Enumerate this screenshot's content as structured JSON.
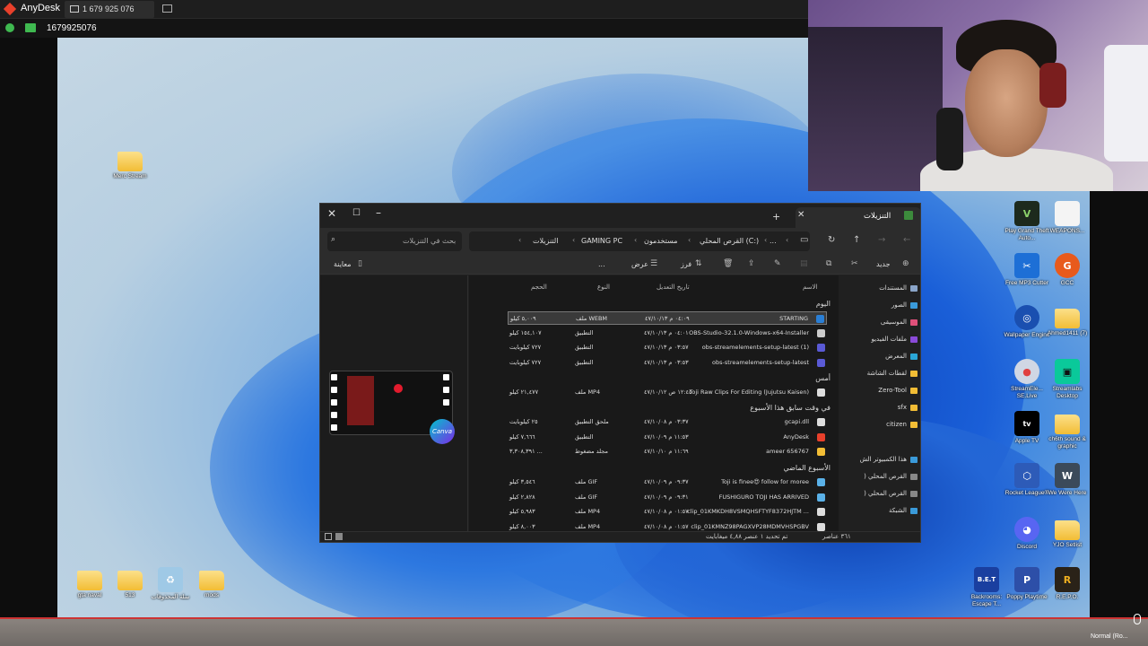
{
  "anydesk": {
    "app_name": "AnyDesk",
    "tab_address": "1 679 925 076",
    "session_id": "1679925076",
    "status_text": "Normal (Ro..."
  },
  "desktop_icons": [
    {
      "label": "Merc Stream",
      "icon": "folder-icon"
    },
    {
      "label": "gta naval",
      "icon": "folder-icon"
    },
    {
      "label": "513",
      "icon": "folder-icon"
    },
    {
      "label": "سلة المحذوفات",
      "icon": "recycle-bin-icon"
    },
    {
      "label": "mods",
      "icon": "folder-icon"
    },
    {
      "label": "Play Grand Theft Auto...",
      "icon": "gta-v-icon"
    },
    {
      "label": "WEAPONS...",
      "icon": "file-icon"
    },
    {
      "label": "Free MP3 Cutter",
      "icon": "mp3-cutter-icon"
    },
    {
      "label": "GCC",
      "icon": "gcc-icon"
    },
    {
      "label": "Wallpaper Engine",
      "icon": "wallpaper-engine-icon"
    },
    {
      "label": "Ahmed1411 (7)",
      "icon": "folder-icon"
    },
    {
      "label": "StreamEle... SE.Live",
      "icon": "streamelements-icon"
    },
    {
      "label": "Streamlabs Desktop",
      "icon": "streamlabs-icon"
    },
    {
      "label": "Apple TV",
      "icon": "apple-tv-icon"
    },
    {
      "label": "ch6th sound & graphic",
      "icon": "folder-icon"
    },
    {
      "label": "Rocket League®",
      "icon": "rocket-league-icon"
    },
    {
      "label": "We Were Here",
      "icon": "we-were-here-icon"
    },
    {
      "label": "Discord",
      "icon": "discord-icon"
    },
    {
      "label": "YJO Setlist",
      "icon": "folder-icon"
    },
    {
      "label": "Backrooms: Escape T...",
      "icon": "bet-game-icon"
    },
    {
      "label": "Poppy Playtime",
      "icon": "poppy-playtime-icon"
    },
    {
      "label": "R.E.P.O.",
      "icon": "repo-game-icon"
    }
  ],
  "explorer": {
    "tab_title": "التنزيلات",
    "search_placeholder": "بحث في التنزيلات",
    "breadcrumbs": [
      "التنزيلات",
      "GAMING PC",
      "مستخدمون",
      "القرص المحلي (C:)"
    ],
    "more_crumbs": "...",
    "toolbar": {
      "new": "جديد",
      "sort": "فرز",
      "view": "عرض",
      "more": "...",
      "preview": "معاينة"
    },
    "columns": {
      "name": "الاسم",
      "date": "تاريخ التعديل",
      "type": "النوع",
      "size": "الحجم"
    },
    "groups": [
      {
        "title": "اليوم",
        "rows": [
          {
            "name": "STARTING",
            "date": "٠٤:٠٩ م ٤٧/١٠/١٣",
            "type": "ملف WEBM",
            "size": "٥,٠٠٩ كيلو",
            "selected": true,
            "icon_color": "#2a7fd6"
          },
          {
            "name": "OBS-Studio-32.1.0-Windows-x64-Installer",
            "date": "٠٤:٠١ م ٤٧/١٠/١٣",
            "type": "التطبيق",
            "size": "١٥٤,١٠٧ كيلو",
            "icon_color": "#cccccc"
          },
          {
            "name": "obs-streamelements-setup-latest (1)",
            "date": "٠٣:٥٧ م ٤٧/١٠/١٣",
            "type": "التطبيق",
            "size": "٧٢٧ كيلوبايت",
            "icon_color": "#5a5ad6"
          },
          {
            "name": "obs-streamelements-setup-latest",
            "date": "٠٣:٥٣ م ٤٧/١٠/١٣",
            "type": "التطبيق",
            "size": "٧٢٧ كيلوبايت",
            "icon_color": "#5a5ad6"
          }
        ]
      },
      {
        "title": "أمس",
        "rows": [
          {
            "name": "Toji Raw Clips For Editing (Jujutsu Kaisen)",
            "date": "١٢:٤٥ ص ٤٧/١٠/١٢",
            "type": "ملف MP4",
            "size": "٢١,٤٧٧ كيلو",
            "icon_color": "#dddddd"
          }
        ]
      },
      {
        "title": "في وقت سابق هذا الأسبوع",
        "rows": [
          {
            "name": "gcapi.dll",
            "date": "٠٣:٣٧ م ٤٧/١٠/٠٨",
            "type": "ملحق التطبيق",
            "size": "٢٥ كيلوبايت",
            "icon_color": "#dddddd"
          },
          {
            "name": "AnyDesk",
            "date": "١١:٥٣ م ٤٧/١٠/٠٩",
            "type": "التطبيق",
            "size": "٧,٦٦٦ كيلو",
            "icon_color": "#e8402b"
          },
          {
            "name": "ameer 656767",
            "date": "١١:٦٩ م ٤٧/١٠/١٠",
            "type": "مجلد مضغوط",
            "size": "٣,٣٠٨,٣٩١ ...",
            "icon_color": "#f2bd35"
          }
        ]
      },
      {
        "title": "الأسبوع الماضي",
        "rows": [
          {
            "name": "Toji is finee😍 follow for moree",
            "date": "٠٩:٣٧ م ٤٧/١٠/٠٩",
            "type": "ملف GIF",
            "size": "٣,٥٤٦ كيلو",
            "icon_color": "#5ab1e8"
          },
          {
            "name": "FUSHIGURO TOJI HAS ARRIVED",
            "date": "٠٩:٣١ م ٤٧/١٠/٠٩",
            "type": "ملف GIF",
            "size": "٢,٨٢٨ كيلو",
            "icon_color": "#5ab1e8"
          },
          {
            "name": "clip_01KMKDH8VSMQHSFTYF8372HJTM ...",
            "date": "٠١:٥٧ م ٤٧/١٠/٠٨",
            "type": "ملف MP4",
            "size": "٥,٩٨٣ كيلو",
            "icon_color": "#dddddd"
          },
          {
            "name": "clip_01KMNZ98PAGXVP28MDMVHSPGBV",
            "date": "٠١:٥٧ م ٤٧/١٠/٠٨",
            "type": "ملف MP4",
            "size": "٨,٠٠٣ كيلو",
            "icon_color": "#dddddd"
          }
        ]
      }
    ],
    "nav": [
      {
        "label": "المستندات",
        "color": "#8aa4c8"
      },
      {
        "label": "الصور",
        "color": "#3a9ad9"
      },
      {
        "label": "الموسيقى",
        "color": "#e0507a"
      },
      {
        "label": "ملفات الفيديو",
        "color": "#8a4ad9"
      },
      {
        "label": "المعرض",
        "color": "#2aa6d6"
      },
      {
        "label": "لقطات الشاشة",
        "color": "#f2bd35"
      },
      {
        "label": "Zero-Tool",
        "color": "#f2bd35"
      },
      {
        "label": "sfx",
        "color": "#f2bd35"
      },
      {
        "label": "citizen",
        "color": "#f2bd35"
      },
      {
        "label": "هذا الكمبيوتر الش",
        "color": "#3a9ad9"
      },
      {
        "label": "القرص المحلي (",
        "color": "#888888"
      },
      {
        "label": "القرص المحلي (",
        "color": "#888888"
      },
      {
        "label": "الشبكة",
        "color": "#3a9ad9"
      }
    ],
    "status": {
      "items": "٣٦١ عناصر",
      "selected": "تم تحديد ١ عنصر ٤,٨٨ ميغابايت"
    }
  }
}
